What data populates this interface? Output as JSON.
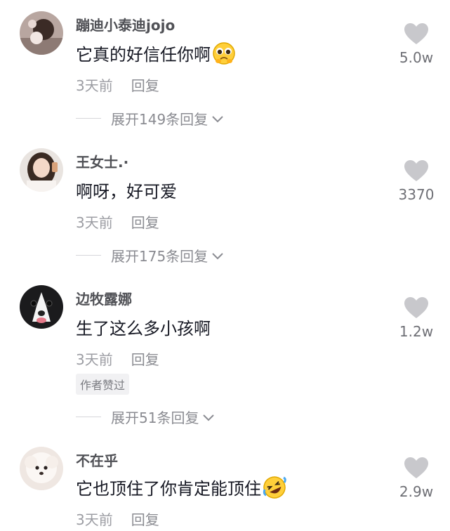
{
  "comments": [
    {
      "username": "蹦迪小泰迪jojo",
      "text": "它真的好信任你啊",
      "emoji": "pleading-face",
      "time": "3天前",
      "reply_label": "回复",
      "likes": "5.0w",
      "expand": "展开149条回复"
    },
    {
      "username": "王女士.·",
      "text": "啊呀，好可爱",
      "time": "3天前",
      "reply_label": "回复",
      "likes": "3370",
      "expand": "展开175条回复"
    },
    {
      "username": "边牧露娜",
      "text": "生了这么多小孩啊",
      "time": "3天前",
      "reply_label": "回复",
      "likes": "1.2w",
      "badge": "作者赞过",
      "expand": "展开51条回复"
    },
    {
      "username": "不在乎",
      "text": "它也顶住了你肯定能顶住",
      "emoji": "rolling-laughing-face",
      "time": "3天前",
      "reply_label": "回复",
      "likes": "2.9w"
    }
  ],
  "colors": {
    "username": "#505156",
    "text": "#161823",
    "meta": "#9c9da3",
    "heart": "#c8c8cc"
  },
  "icons": {
    "like": "heart-icon",
    "expand": "chevron-down-icon"
  }
}
